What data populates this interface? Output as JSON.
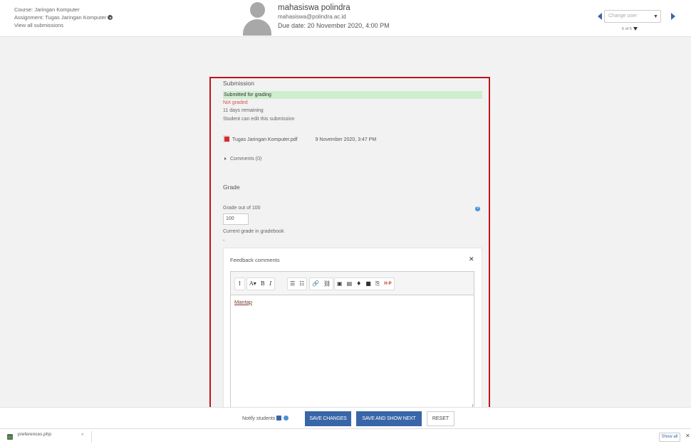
{
  "header": {
    "course": "Course: Jaringan Komputer",
    "assignment": "Assignment: Tugas Jaringan Komputer",
    "view_all": "View all submissions",
    "user_name": "mahasiswa polindra",
    "user_email": "mahasiswa@polindra.ac.id",
    "due_date": "Due date: 20 November 2020, 4:00 PM",
    "change_user_placeholder": "Change user",
    "user_count": "6 of 6"
  },
  "submission": {
    "heading": "Submission",
    "status": "Submitted for grading",
    "grading_status": "Not graded",
    "time_remaining": "11 days remaining",
    "edit_status": "Student can edit this submission",
    "file_name": "Tugas Jaringan Komputer.pdf",
    "file_date": "9 November 2020, 3:47 PM",
    "comments": "Comments (0)"
  },
  "grade": {
    "heading": "Grade",
    "label": "Grade out of 100",
    "value": "100",
    "gradebook_label": "Current grade in gradebook",
    "gradebook_value": "-"
  },
  "feedback": {
    "label": "Feedback comments",
    "text": "Mantap",
    "toolbar": [
      "↕",
      "A▾",
      "B",
      "I",
      "☰",
      "☷",
      "🔗",
      "⛓",
      "▣",
      "▤",
      "♦",
      "■",
      "⎘",
      "H-P"
    ]
  },
  "footer": {
    "notify_label": "Notify students",
    "save_changes": "SAVE CHANGES",
    "save_show_next": "SAVE AND SHOW NEXT",
    "reset": "RESET"
  },
  "downloads": {
    "file": "preferences.php",
    "show_all": "Show all"
  },
  "colors": {
    "accent": "#3866a8",
    "highlight_frame": "#c0141a",
    "submitted_bg": "#cfeecf",
    "not_graded": "#d9534f"
  }
}
